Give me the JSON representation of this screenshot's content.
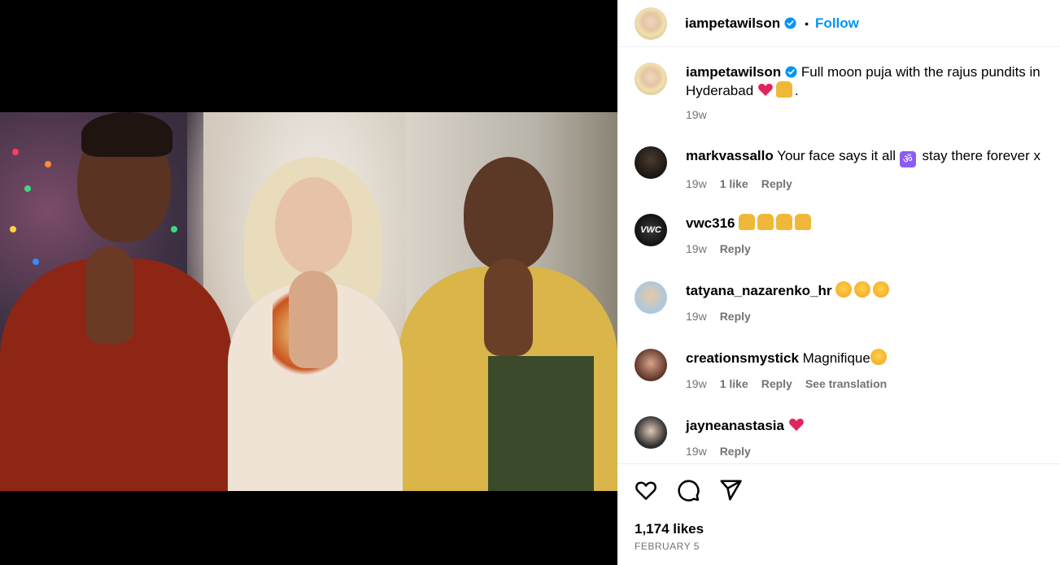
{
  "post": {
    "author": "iampetawilson",
    "follow_label": "Follow",
    "separator": "•",
    "caption_user": "iampetawilson",
    "caption_text": "Full moon puja with the rajus pundits in Hyderabad",
    "caption_suffix": ".",
    "caption_time": "19w"
  },
  "comments": [
    {
      "user": "markvassallo",
      "text_before": "Your face says it all",
      "text_after": "stay there forever x",
      "time": "19w",
      "likes": "1 like",
      "reply": "Reply"
    },
    {
      "user": "vwc316",
      "time": "19w",
      "reply": "Reply",
      "avatar_text": "VWC"
    },
    {
      "user": "tatyana_nazarenko_hr",
      "time": "19w",
      "reply": "Reply"
    },
    {
      "user": "creationsmystick",
      "text": "Magnifique",
      "time": "19w",
      "likes": "1 like",
      "reply": "Reply",
      "translate": "See translation"
    },
    {
      "user": "jayneanastasia",
      "time": "19w",
      "reply": "Reply"
    }
  ],
  "footer": {
    "likes": "1,174 likes",
    "date": "FEBRUARY 5"
  },
  "icons": {
    "verified": "verified-badge-icon",
    "like": "heart-outline-icon",
    "comment": "comment-bubble-icon",
    "share": "paper-plane-icon"
  },
  "colors": {
    "accent": "#0095f6",
    "muted": "#737373",
    "heart": "#e0245e"
  }
}
